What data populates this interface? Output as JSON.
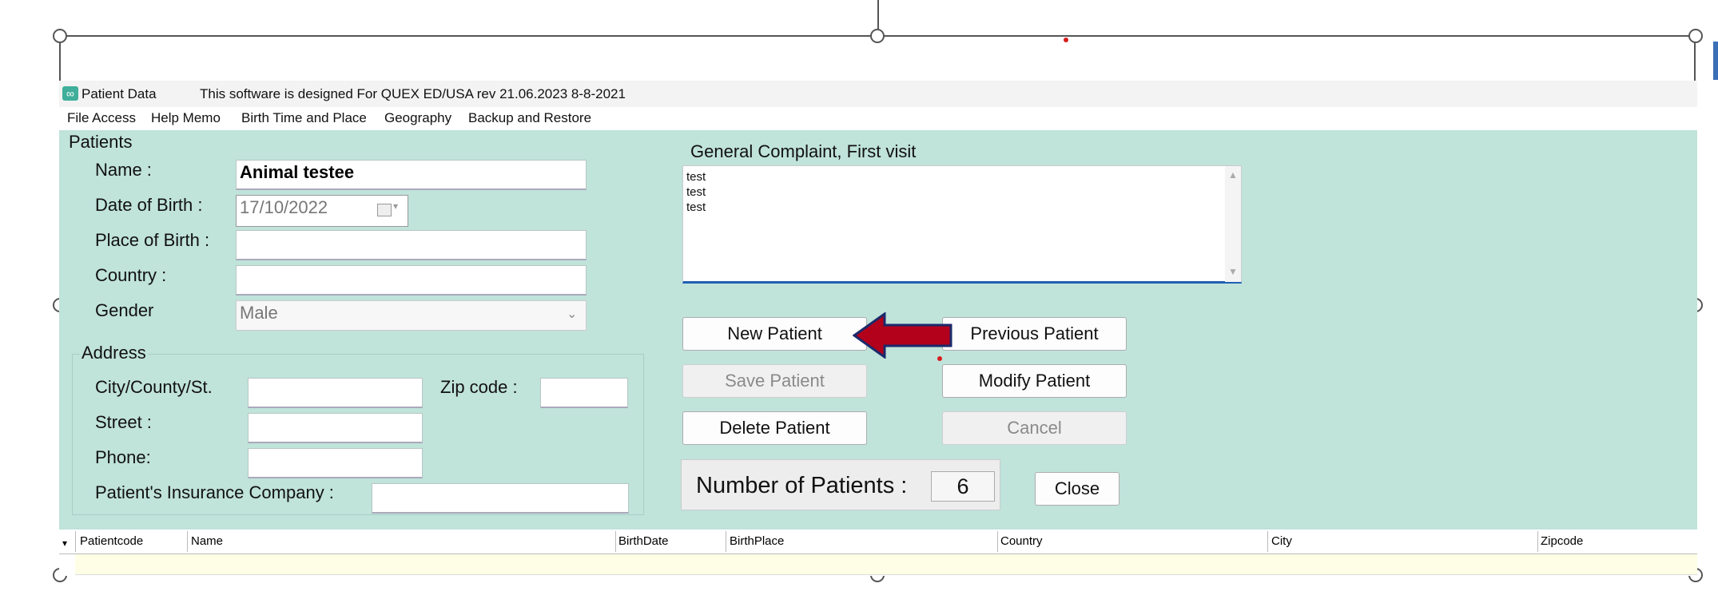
{
  "window": {
    "app_icon": "infinity-icon",
    "title": "Patient Data",
    "subtitle": "This software is designed For QUEX ED/USA rev 21.06.2023 8-8-2021"
  },
  "menu": [
    "File Access",
    "Help Memo",
    "Birth Time and Place",
    "Geography",
    "Backup and Restore"
  ],
  "patients": {
    "group_label": "Patients",
    "name_label": "Name :",
    "name_value": "Animal testee",
    "dob_label": "Date of Birth :",
    "dob_value": "17/10/2022",
    "place_label": "Place of Birth :",
    "place_value": "",
    "country_label": "Country :",
    "country_value": "",
    "gender_label": "Gender",
    "gender_value": "Male"
  },
  "address": {
    "group_label": "Address",
    "city_label": "City/County/St.",
    "zip_label": "Zip code :",
    "street_label": "Street :",
    "phone_label": "Phone:",
    "insurance_label": "Patient's Insurance Company :"
  },
  "complaint": {
    "label": "General Complaint, First visit",
    "text": "test\ntest\ntest"
  },
  "buttons": {
    "new_patient": "New Patient",
    "previous_patient": "Previous Patient",
    "save_patient": "Save Patient",
    "modify_patient": "Modify Patient",
    "delete_patient": "Delete Patient",
    "cancel": "Cancel",
    "close": "Close"
  },
  "count": {
    "label": "Number of Patients :",
    "value": "6"
  },
  "grid": {
    "columns": [
      "Patientcode",
      "Name",
      "BirthDate",
      "BirthPlace",
      "Country",
      "City",
      "Zipcode"
    ],
    "row_indicator": "▾"
  },
  "colors": {
    "form_background": "#c0e3da",
    "arrow": "#b3001b",
    "row_highlight": "#fefee6",
    "focus_underline": "#1f5fb3"
  }
}
